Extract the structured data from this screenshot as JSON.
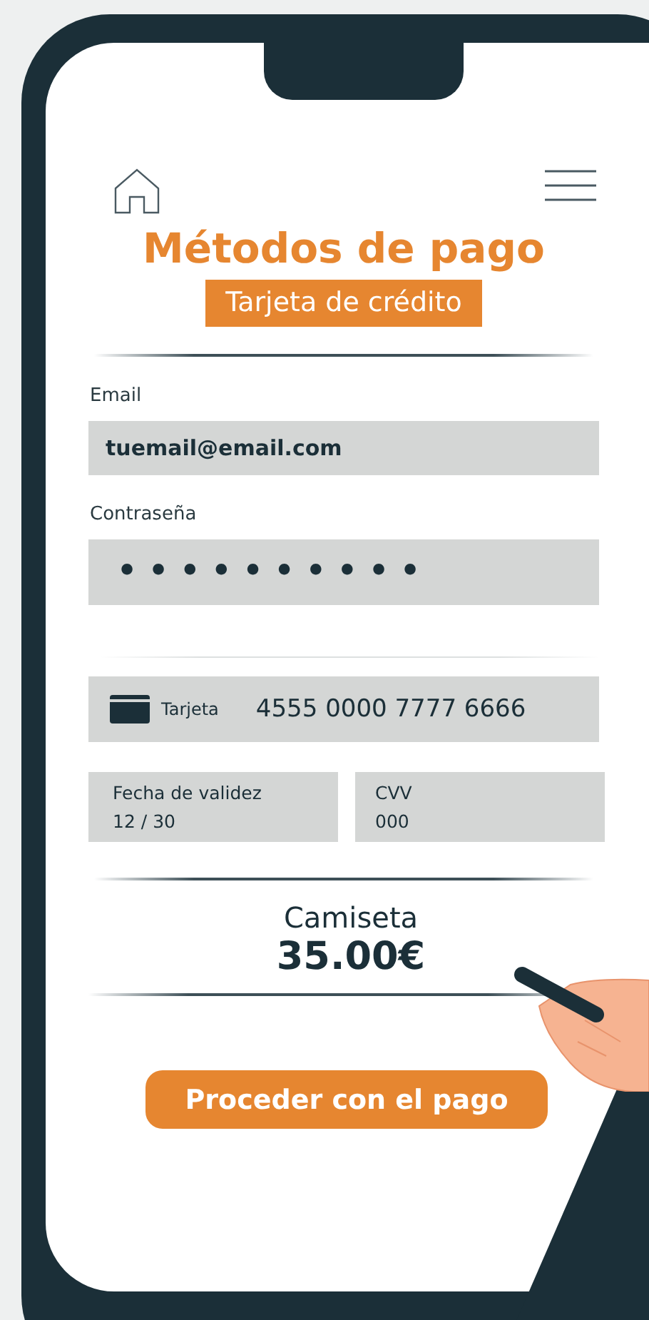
{
  "header": {
    "title": "Métodos de pago",
    "subtitle": "Tarjeta de crédito"
  },
  "account": [
    {
      "kind": "text",
      "label": "Email",
      "value": "tuemail@email.com"
    },
    {
      "kind": "masked",
      "label": "Contraseña",
      "value": "••••••••••"
    }
  ],
  "card": {
    "label": "Tarjeta",
    "number": "4555 0000 7777 6666"
  },
  "card_details": [
    {
      "label": "Fecha de validez",
      "value": "12 / 30"
    },
    {
      "label": "CVV",
      "value": "000"
    }
  ],
  "summary": {
    "product": "Camiseta",
    "price": "35.00€"
  },
  "button": "Proceder con el pago"
}
